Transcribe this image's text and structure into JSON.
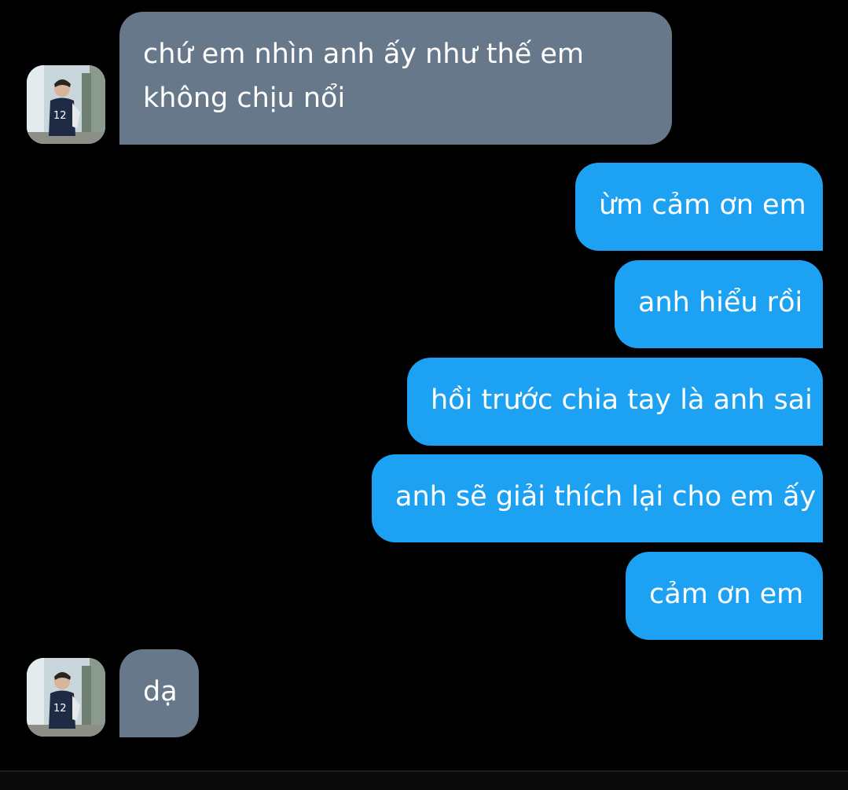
{
  "messages": [
    {
      "id": "m1",
      "direction": "incoming",
      "lines": [
        "chứ em nhìn anh ấy như thế em",
        "không chịu nổi"
      ]
    },
    {
      "id": "m2",
      "direction": "outgoing",
      "text": "ừm cảm ơn em"
    },
    {
      "id": "m3",
      "direction": "outgoing",
      "text": "anh hiểu rồi"
    },
    {
      "id": "m4",
      "direction": "outgoing",
      "text": "hồi trước chia tay là anh sai"
    },
    {
      "id": "m5",
      "direction": "outgoing",
      "text": "anh sẽ giải thích lại cho em ấy"
    },
    {
      "id": "m6",
      "direction": "outgoing",
      "text": "cảm ơn em"
    },
    {
      "id": "m7",
      "direction": "incoming",
      "text": "dạ"
    }
  ],
  "colors": {
    "background": "#000000",
    "incoming_bubble": "#66788a",
    "outgoing_bubble": "#1da1f2",
    "text": "#ffffff"
  },
  "icons": {
    "avatar": "contact-avatar-photo"
  }
}
